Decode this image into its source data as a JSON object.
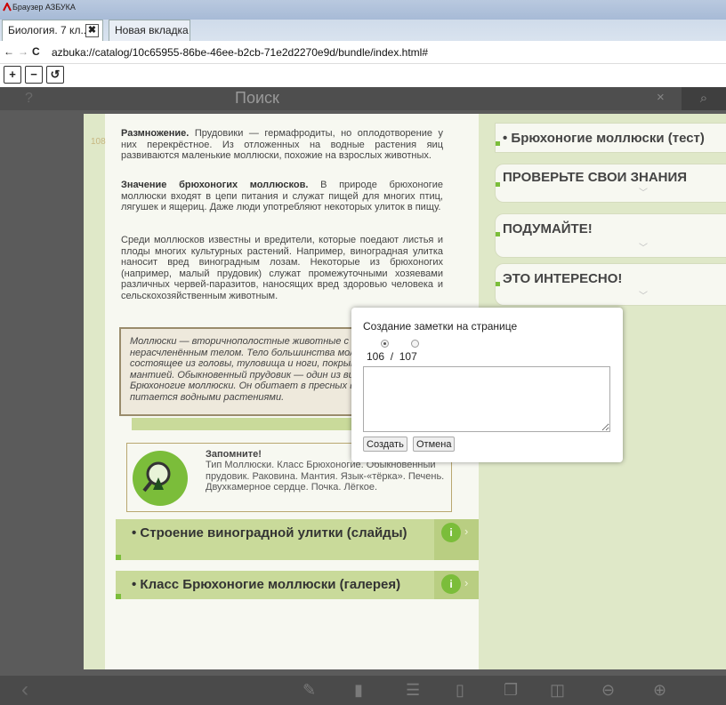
{
  "browser": {
    "app_name": "Браузер АЗБУКА",
    "tabs": [
      {
        "label": "Биология. 7 кл...",
        "close": "✖"
      },
      {
        "label": "Новая вкладка"
      }
    ],
    "url": "azbuka://catalog/10c65955-86be-46ee-b2cb-71e2d2270e9d/bundle/index.html#",
    "nav_icons": {
      "back": "←",
      "forward": "→",
      "reload": "C"
    },
    "zoom_buttons": [
      "+",
      "−",
      "↺"
    ]
  },
  "search": {
    "help": "?",
    "placeholder": "Поиск",
    "clear": "×",
    "go_icon": "⌕"
  },
  "page_number": "108",
  "paragraphs": [
    {
      "bold": "Размножение.",
      "text": " Прудовики — гермафродиты, но оплодотворение у них перекрёстное. Из отложенных на водные растения яиц развиваются маленькие моллюски, похожие на взрослых животных."
    },
    {
      "bold": "Значение брюхоногих моллюсков.",
      "text": " В природе брюхоногие моллюски входят в цепи питания и служат пищей для многих птиц, лягушек и ящериц. Даже люди употребляют некоторых улиток в пищу."
    },
    {
      "bold": "",
      "text": "Среди моллюсков известны и вредители, которые поедают листья и плоды многих культурных растений. Например, виноградная улитка наносит вред виноградным лозам. Некоторые из брюхоногих (например, малый прудовик) служат промежуточными хозяевами различных червей-паразитов, наносящих вред здоровью человека и сельскохозяйственным животным."
    }
  ],
  "italic_box": "Моллюски — вторичнополостные животные с мягким нерасчленённым телом. Тело большинства моллюсков состоящее из головы, туловища и ноги, покрыто образованной мантией. Обыкновенный прудовик — один из видов класса Брюхоногие моллюски. Он обитает в пресных водоёмах и питается водными растениями.",
  "remember": {
    "title": "Запомните!",
    "text": "Тип Моллюски. Класс Брюхоногие. Обыкновенный прудовик. Раковина. Мантия. Язык-«тёрка». Печень. Двухкамерное сердце. Почка. Лёгкое."
  },
  "gallery_buttons": [
    {
      "label": "• Строение виноградной улитки (слайды)"
    },
    {
      "label": "• Класс Брюхоногие моллюски (галерея)"
    }
  ],
  "accordions": [
    {
      "title": "• Брюхоногие моллюски (тест)"
    },
    {
      "title": "ПРОВЕРЬТЕ СВОИ ЗНАНИЯ"
    },
    {
      "title": "ПОДУМАЙТЕ!"
    },
    {
      "title": "ЭТО ИНТЕРЕСНО!"
    }
  ],
  "dialog": {
    "title": "Создание заметки на странице",
    "page_a": "106",
    "separator": "/",
    "page_b": "107",
    "note_value": "",
    "create_label": "Создать",
    "cancel_label": "Отмена"
  },
  "bottom_icons": [
    "pencil-icon",
    "bookmark-icon",
    "list-icon",
    "page-icon",
    "copy-icon",
    "book-icon",
    "zoom-out-icon",
    "zoom-in-icon"
  ],
  "colors": {
    "accent_green": "#7bbd3a",
    "page_bg": "#dfe8c8",
    "app_bg": "#5b5b5b"
  }
}
